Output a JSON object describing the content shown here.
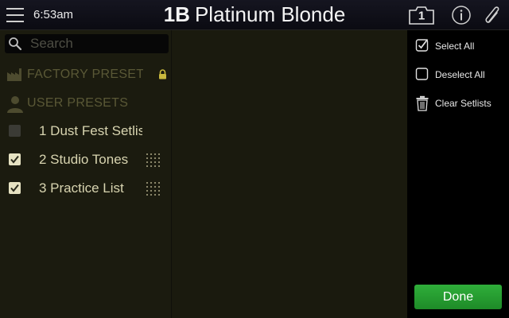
{
  "topbar": {
    "time": "6:53am",
    "preset_number": "1B",
    "preset_name": "Platinum Blonde",
    "snapshot_badge": "1",
    "icons": [
      "menu-icon",
      "camera-snapshot-icon",
      "info-icon",
      "paperclip-icon"
    ]
  },
  "search": {
    "placeholder": "Search",
    "value": ""
  },
  "sections": {
    "factory": {
      "label": "FACTORY PRESETS",
      "icon": "factory-icon",
      "locked": true
    },
    "user": {
      "label": "USER PRESETS",
      "icon": "user-icon"
    }
  },
  "setlists": [
    {
      "label": "1  Dust Fest Setlis",
      "checked": false,
      "draggable": false
    },
    {
      "label": "2  Studio Tones",
      "checked": true,
      "draggable": true
    },
    {
      "label": "3  Practice List",
      "checked": true,
      "draggable": true
    }
  ],
  "menu": {
    "select_all": "Select All",
    "deselect_all": "Deselect All",
    "clear_setlists": "Clear Setlists"
  },
  "done_label": "Done",
  "colors": {
    "accent_green": "#27a032",
    "panel_bg": "#1b1b0f",
    "text_muted": "#5a5836"
  }
}
